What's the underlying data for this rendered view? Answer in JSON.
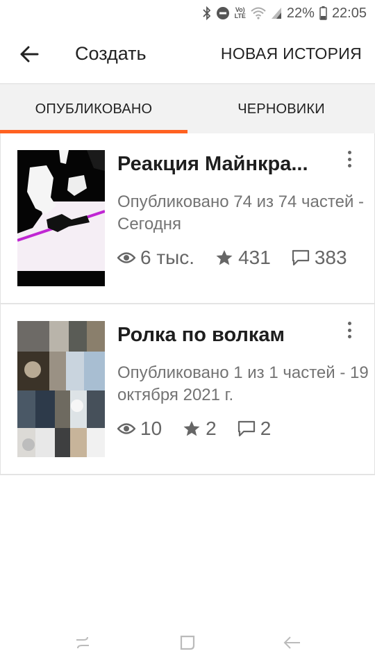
{
  "status_bar": {
    "battery_percent": "22%",
    "time": "22:05",
    "volte_top": "Vo)",
    "volte_bottom": "LTE"
  },
  "header": {
    "title": "Создать",
    "new_story_label": "НОВАЯ ИСТОРИЯ"
  },
  "tabs": [
    {
      "label": "ОПУБЛИКОВАНО",
      "active": true
    },
    {
      "label": "ЧЕРНОВИКИ",
      "active": false
    }
  ],
  "accent_color": "#ff6120",
  "stories": [
    {
      "title": "Реакция Майнкра...",
      "subtitle": "Опубликовано 74 из 74 частей - Сегодня",
      "views": "6 тыс.",
      "stars": "431",
      "comments": "383"
    },
    {
      "title": "Ролка по волкам",
      "subtitle": "Опубликовано 1 из 1 частей - 19 октября 2021 г.",
      "views": "10",
      "stars": "2",
      "comments": "2"
    }
  ],
  "icons": {
    "views": "eye-icon",
    "stars": "star-icon",
    "comments": "comment-icon",
    "more": "more-vertical-icon",
    "back": "arrow-back-icon"
  }
}
